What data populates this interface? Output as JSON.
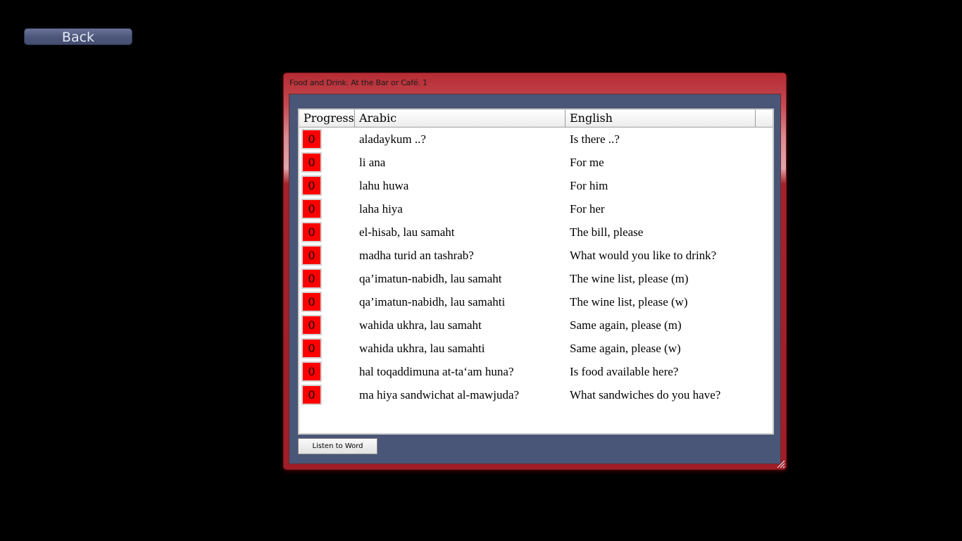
{
  "nav": {
    "back_label": "Back"
  },
  "window": {
    "title": "Food and Drink. At the Bar or Café. 1"
  },
  "table": {
    "columns": [
      "Progress",
      "Arabic",
      "English"
    ],
    "rows": [
      {
        "progress": "0",
        "arabic": "aladaykum ..?",
        "english": "Is there ..?"
      },
      {
        "progress": "0",
        "arabic": "li ana",
        "english": "For me"
      },
      {
        "progress": "0",
        "arabic": "lahu huwa",
        "english": "For him"
      },
      {
        "progress": "0",
        "arabic": "laha hiya",
        "english": "For her"
      },
      {
        "progress": "0",
        "arabic": "el-hisab, lau samaht",
        "english": "The bill, please"
      },
      {
        "progress": "0",
        "arabic": "madha turid an tashrab?",
        "english": "What would you like to drink?"
      },
      {
        "progress": "0",
        "arabic": "qa’imatun-nabidh, lau samaht",
        "english": "The wine list, please (m)"
      },
      {
        "progress": "0",
        "arabic": "qa’imatun-nabidh, lau samahti",
        "english": "The wine list, please (w)"
      },
      {
        "progress": "0",
        "arabic": "wahida ukhra, lau samaht",
        "english": "Same again, please (m)"
      },
      {
        "progress": "0",
        "arabic": "wahida ukhra, lau samahti",
        "english": "Same again, please (w)"
      },
      {
        "progress": "0",
        "arabic": "hal toqaddimuna at-ta‘am huna?",
        "english": "Is food available here?"
      },
      {
        "progress": "0",
        "arabic": "ma hiya sandwichat al-mawjuda?",
        "english": "What sandwiches do you have?"
      }
    ]
  },
  "actions": {
    "listen_label": "Listen to Word"
  },
  "colors": {
    "progress_zero": "#ff0000",
    "window_frame": "#a11e28",
    "client_bg": "#4a5677"
  }
}
